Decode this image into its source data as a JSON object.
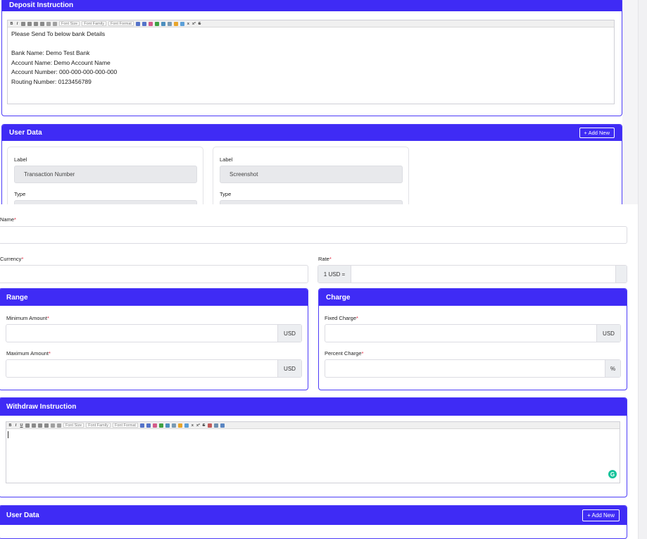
{
  "deposit_instruction": {
    "title": "Deposit Instruction",
    "toolbar": {
      "bold": "B",
      "italic": "I",
      "font_size": "Font Size",
      "font_family": "Font Family",
      "font_format": "Font Format"
    },
    "content": "Please Send To below bank Details\n\nBank Name: Demo Test Bank\nAccount Name: Demo Account Name\nAccount Number: 000-000-000-000-000\nRouting Number: 0123456789"
  },
  "user_data_top": {
    "title": "User Data",
    "add_new": "+ Add New",
    "items": [
      {
        "label_caption": "Label",
        "label_value": "Transaction Number",
        "type_caption": "Type"
      },
      {
        "label_caption": "Label",
        "label_value": "Screenshot",
        "type_caption": "Type"
      }
    ]
  },
  "form": {
    "name_label": "Name",
    "currency_label": "Currency",
    "rate_label": "Rate",
    "rate_prefix": "1 USD =",
    "required_mark": "*"
  },
  "range": {
    "title": "Range",
    "min_label": "Minimum Amount",
    "max_label": "Maximum Amount",
    "unit": "USD"
  },
  "charge": {
    "title": "Charge",
    "fixed_label": "Fixed Charge",
    "percent_label": "Percent Charge",
    "fixed_unit": "USD",
    "percent_unit": "%"
  },
  "withdraw_instruction": {
    "title": "Withdraw Instruction",
    "toolbar": {
      "bold": "B",
      "italic": "I",
      "underline": "U",
      "font_size": "Font Size",
      "font_family": "Font Family",
      "font_format": "Font Format"
    },
    "grammarly_letter": "G"
  },
  "user_data_bottom": {
    "title": "User Data",
    "add_new": "+ Add New"
  },
  "colors": {
    "accent": "#3f2bf5",
    "required": "#e0263e"
  }
}
